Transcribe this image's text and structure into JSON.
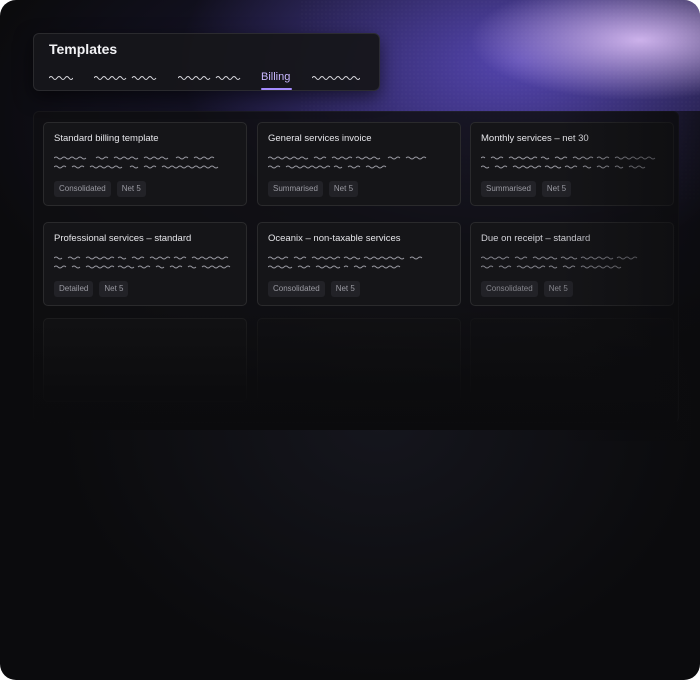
{
  "header": {
    "title": "Templates",
    "tabs": [
      {
        "label": "",
        "state": "inactive"
      },
      {
        "label": "",
        "state": "inactive"
      },
      {
        "label": "",
        "state": "inactive"
      },
      {
        "label": "Billing",
        "state": "active"
      },
      {
        "label": "",
        "state": "inactive"
      }
    ]
  },
  "cards": [
    {
      "title": "Standard billing template",
      "tags": [
        "Consolidated",
        "Net 5"
      ]
    },
    {
      "title": "General services invoice",
      "tags": [
        "Summarised",
        "Net 5"
      ]
    },
    {
      "title": "Monthly services – net 30",
      "tags": [
        "Summarised",
        "Net 5"
      ]
    },
    {
      "title": "Professional services – standard",
      "tags": [
        "Detailed",
        "Net 5"
      ]
    },
    {
      "title": "Oceanix – non-taxable services",
      "tags": [
        "Consolidated",
        "Net 5"
      ]
    },
    {
      "title": "Due on receipt – standard",
      "tags": [
        "Consolidated",
        "Net 5"
      ]
    }
  ],
  "colors": {
    "accent": "#a58cff",
    "background": "#0b0b0d",
    "card": "#151518"
  }
}
